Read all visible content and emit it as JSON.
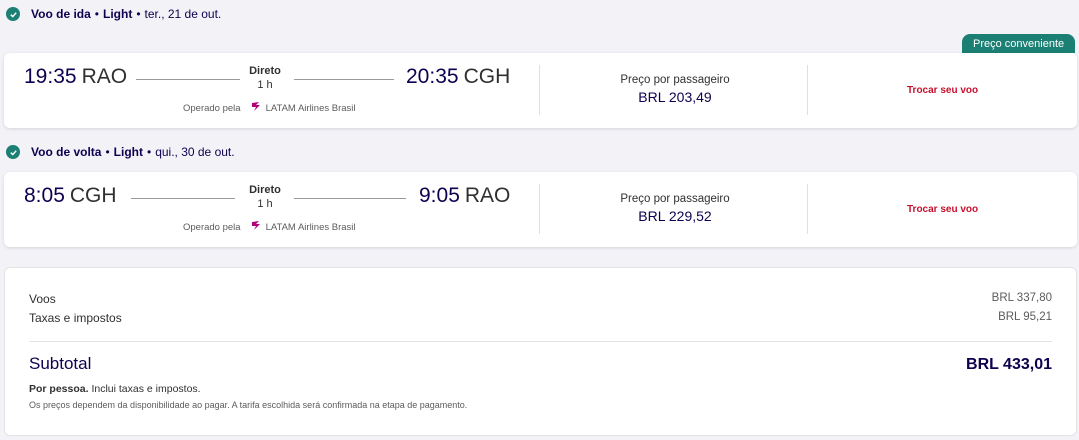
{
  "outbound": {
    "title": "Voo de ida",
    "fare": "Light",
    "date": "ter., 21 de out.",
    "dep_time": "19:35",
    "dep_code": "RAO",
    "arr_time": "20:35",
    "arr_code": "CGH",
    "stops": "Direto",
    "duration": "1 h",
    "operated_label": "Operado pela",
    "airline": "LATAM Airlines Brasil",
    "price_label": "Preço por passageiro",
    "price": "BRL 203,49",
    "change_link": "Trocar seu voo",
    "badge": "Preço conveniente"
  },
  "inbound": {
    "title": "Voo de volta",
    "fare": "Light",
    "date": "qui., 30 de out.",
    "dep_time": "8:05",
    "dep_code": "CGH",
    "arr_time": "9:05",
    "arr_code": "RAO",
    "stops": "Direto",
    "duration": "1 h",
    "operated_label": "Operado pela",
    "airline": "LATAM Airlines Brasil",
    "price_label": "Preço por passageiro",
    "price": "BRL 229,52",
    "change_link": "Trocar seu voo"
  },
  "summary": {
    "flights_label": "Voos",
    "flights_amount": "BRL 337,80",
    "taxes_label": "Taxas e impostos",
    "taxes_amount": "BRL 95,21",
    "subtotal_label": "Subtotal",
    "subtotal_amount": "BRL 433,01",
    "per_person_bold": "Por pessoa.",
    "per_person_text": "Inclui taxas e impostos.",
    "disclaimer": "Os preços dependem da disponibilidade ao pagar. A tarifa escolhida será confirmada na etapa de pagamento."
  },
  "colors": {
    "brand_navy": "#10004f",
    "accent_teal": "#1b7f74",
    "link_red": "#c8102e"
  },
  "icons": {
    "check": "check-circle-icon",
    "airline_logo": "latam-logo-icon"
  }
}
